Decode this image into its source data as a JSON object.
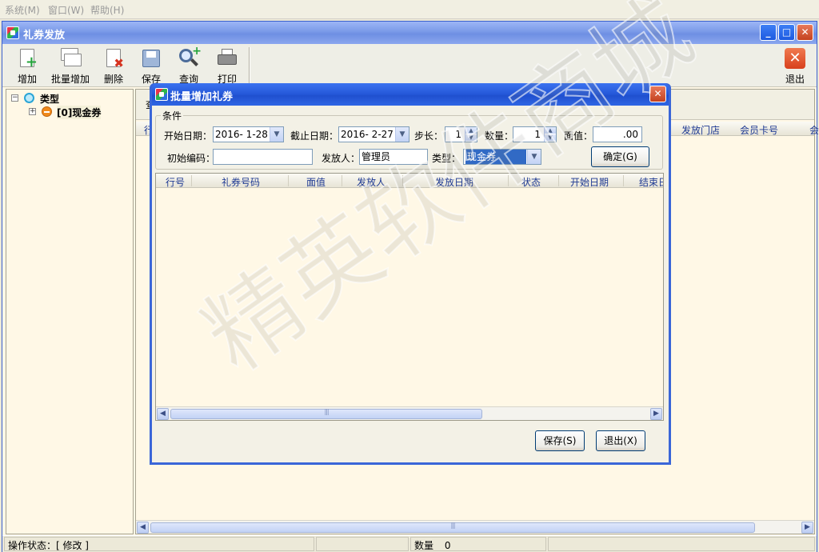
{
  "menubar": {
    "items": [
      "系统(M)",
      "窗口(W)",
      "帮助(H)"
    ]
  },
  "window": {
    "title": "礼券发放",
    "min": "_",
    "max": "□",
    "close": "✕"
  },
  "toolbar": {
    "add": "增加",
    "batch_add": "批量增加",
    "delete": "删除",
    "save": "保存",
    "query": "查询",
    "print": "打印",
    "exit": "退出"
  },
  "tree": {
    "root": "类型",
    "child": "[0]现金券"
  },
  "main_grid": {
    "search_label": "查",
    "headers": [
      "行",
      "发放门店",
      "会员卡号",
      "会"
    ]
  },
  "dialog": {
    "title": "批量增加礼券",
    "group_label": "条件",
    "start_date_label": "开始日期：",
    "start_date": "2016- 1-28",
    "end_date_label": "截止日期：",
    "end_date": "2016- 2-27",
    "step_label": "步长：",
    "step": "1",
    "qty_label": "数量：",
    "qty": "1",
    "face_label": "面值：",
    "face": ".00",
    "init_code_label": "初始编码：",
    "init_code": "",
    "issuer_label": "发放人：",
    "issuer": "管理员",
    "type_label": "类型：",
    "type": "现金券",
    "confirm": "确定(G)",
    "grid_headers": [
      "行号",
      "礼券号码",
      "面值",
      "发放人",
      "发放日期",
      "状态",
      "开始日期",
      "结束日"
    ],
    "save": "保存(S)",
    "exit": "退出(X)",
    "close": "✕"
  },
  "statusbar": {
    "op_status": "操作状态：[ 修改 ]",
    "qty_label": "数量",
    "qty": "0"
  },
  "watermark": "精英软件商城"
}
